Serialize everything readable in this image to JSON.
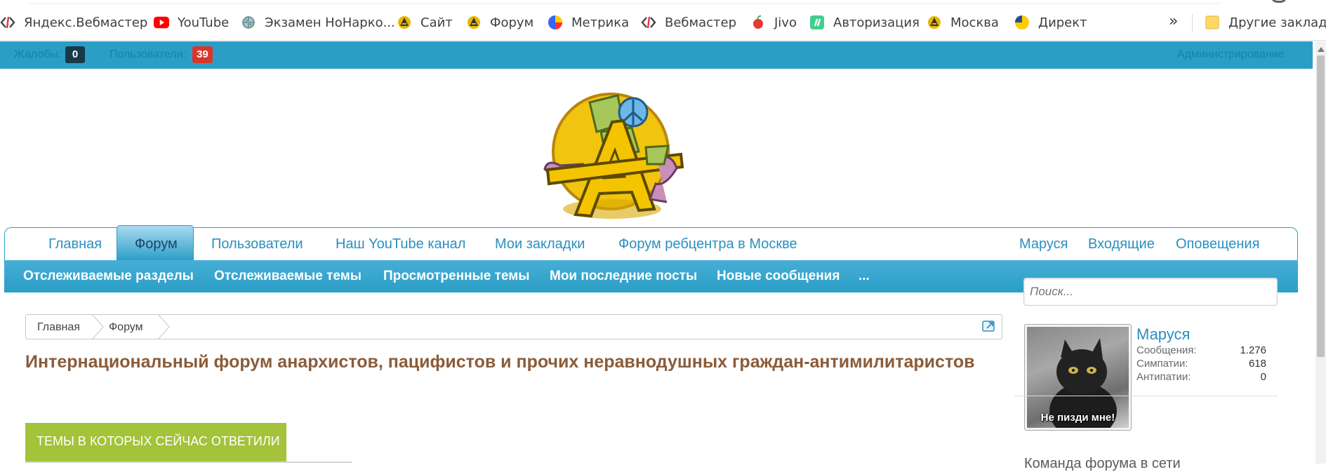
{
  "bookmarks": {
    "items": [
      {
        "label": "Яндекс.Вебмастер",
        "icon": "code-icon"
      },
      {
        "label": "YouTube",
        "icon": "youtube-icon"
      },
      {
        "label": "Экзамен НоНарко...",
        "icon": "globe-icon"
      },
      {
        "label": "Сайт",
        "icon": "site-logo-icon"
      },
      {
        "label": "Форум",
        "icon": "site-logo-icon"
      },
      {
        "label": "Метрика",
        "icon": "metrika-icon"
      },
      {
        "label": "Вебмастер",
        "icon": "code-icon"
      },
      {
        "label": "Jivo",
        "icon": "jivo-icon"
      },
      {
        "label": "Авторизация",
        "icon": "auth-icon"
      },
      {
        "label": "Москва",
        "icon": "site-logo-icon"
      },
      {
        "label": "Директ",
        "icon": "direct-icon"
      }
    ],
    "more": "»",
    "other": "Другие закладки"
  },
  "admin_bar": {
    "reports_label": "Жалобы:",
    "reports_count": "0",
    "users_label": "Пользователи:",
    "users_count": "39",
    "admin_label": "Администрирование"
  },
  "main_nav": {
    "items": [
      "Главная",
      "Форум",
      "Пользователи",
      "Наш YouTube канал",
      "Мои закладки",
      "Форум ребцентра в Москве"
    ],
    "active": "Форум",
    "right": [
      "Маруся",
      "Входящие",
      "Оповещения"
    ]
  },
  "sub_nav": {
    "items": [
      "Отслеживаемые разделы",
      "Отслеживаемые темы",
      "Просмотренные темы",
      "Мои последние посты",
      "Новые сообщения",
      "..."
    ]
  },
  "search": {
    "placeholder": "Поиск..."
  },
  "breadcrumb": {
    "items": [
      "Главная",
      "Форум"
    ]
  },
  "page_title": "Интернациональный форум анархистов, пацифистов и прочих неравнодушных граждан-антимилитаристов",
  "section": {
    "title": "ТЕМЫ В КОТОРЫХ СЕЙЧАС ОТВЕТИЛИ"
  },
  "sidebar": {
    "username": "Маруся",
    "avatar_caption": "Не пизди мне!",
    "stats": [
      {
        "label": "Сообщения:",
        "value": "1.276"
      },
      {
        "label": "Симпатии:",
        "value": "618"
      },
      {
        "label": "Антипатии:",
        "value": "0"
      }
    ],
    "next_heading": "Команда форума в сети"
  },
  "colors": {
    "accent": "#2b9ec6",
    "title": "#8a5c3a",
    "section_green": "#a2c33a",
    "badge_dark": "#173a4a",
    "badge_red": "#d9362b"
  }
}
